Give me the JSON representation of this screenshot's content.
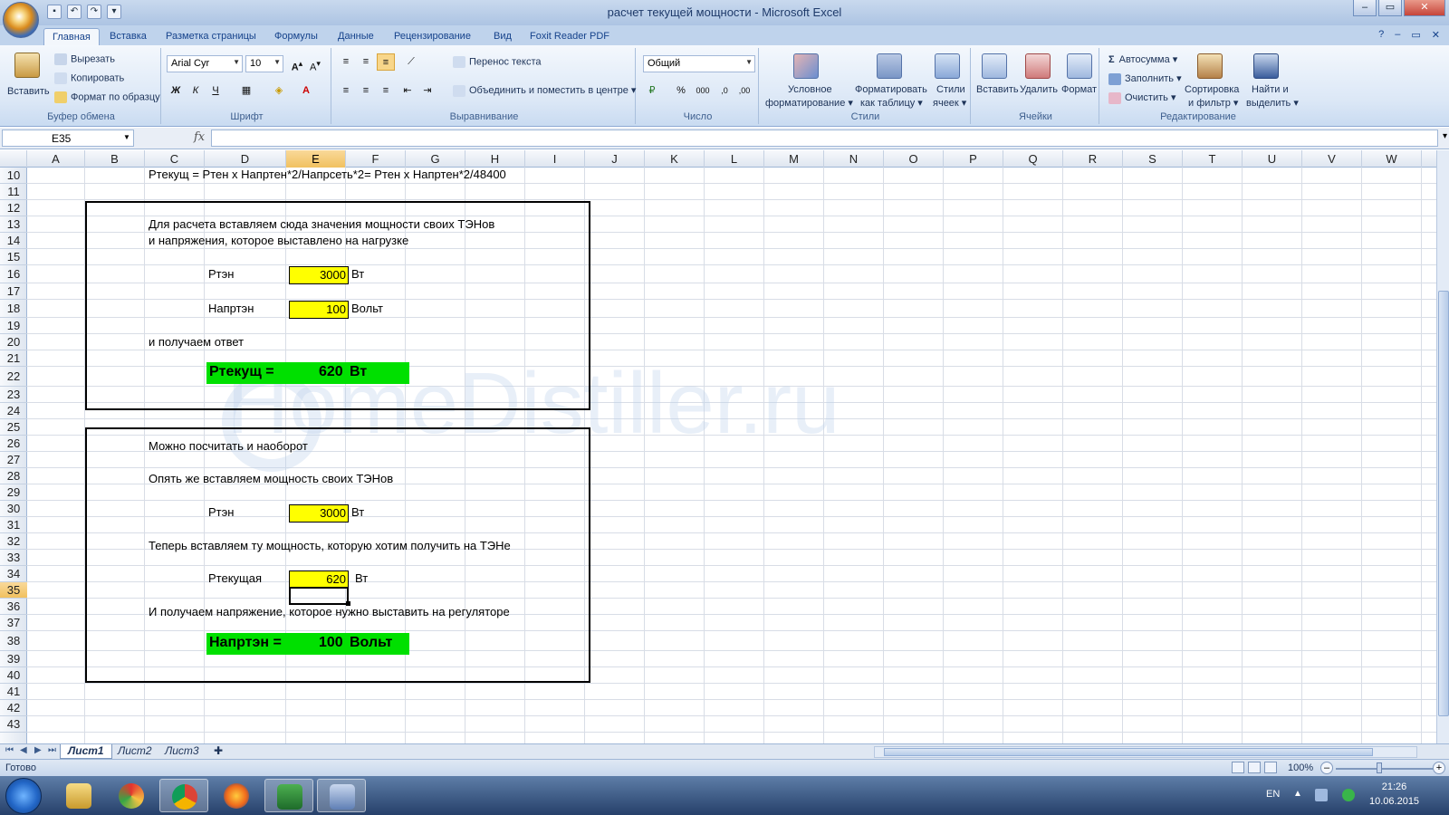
{
  "window": {
    "title": "расчет текущей мощности - Microsoft Excel",
    "controls": {
      "minimize": "–",
      "restore": "▭",
      "close": "✕"
    }
  },
  "tabs": [
    "Главная",
    "Вставка",
    "Разметка страницы",
    "Формулы",
    "Данные",
    "Рецензирование",
    "Вид",
    "Foxit Reader PDF"
  ],
  "ribbon": {
    "clipboard": {
      "paste": "Вставить",
      "cut": "Вырезать",
      "copy": "Копировать",
      "format_painter": "Формат по образцу",
      "label": "Буфер обмена"
    },
    "font": {
      "name": "Arial Cyr",
      "size": "10",
      "bold": "Ж",
      "italic": "К",
      "underline": "Ч",
      "label": "Шрифт"
    },
    "alignment": {
      "wrap": "Перенос текста",
      "merge": "Объединить и поместить в центре",
      "label": "Выравнивание"
    },
    "number": {
      "format": "Общий",
      "percent": "%",
      "thousands": "000",
      "label": "Число"
    },
    "styles": {
      "conditional": "Условное",
      "conditional2": "форматирование",
      "format_table": "Форматировать",
      "format_table2": "как таблицу",
      "cell_styles": "Стили",
      "cell_styles2": "ячеек",
      "label": "Стили"
    },
    "cells": {
      "insert": "Вставить",
      "delete": "Удалить",
      "format": "Формат",
      "label": "Ячейки"
    },
    "editing": {
      "autosum": "Автосумма",
      "fill": "Заполнить",
      "clear": "Очистить",
      "sort": "Сортировка",
      "sort2": "и фильтр",
      "find": "Найти и",
      "find2": "выделить",
      "label": "Редактирование"
    }
  },
  "formula_bar": {
    "name_box": "E35",
    "fx": "fx",
    "value": ""
  },
  "columns": [
    "A",
    "B",
    "C",
    "D",
    "E",
    "F",
    "G",
    "H",
    "I",
    "J",
    "K",
    "L",
    "M",
    "N",
    "O",
    "P",
    "Q",
    "R",
    "S",
    "T",
    "U",
    "V",
    "W"
  ],
  "selected_column": "E",
  "rows": [
    "10",
    "11",
    "12",
    "13",
    "14",
    "15",
    "16",
    "17",
    "18",
    "19",
    "20",
    "21",
    "22",
    "23",
    "24",
    "25",
    "26",
    "27",
    "28",
    "29",
    "30",
    "31",
    "32",
    "33",
    "34",
    "35",
    "36",
    "37",
    "38",
    "39",
    "40",
    "41",
    "42",
    "43"
  ],
  "selected_row": "35",
  "sheet": {
    "formula_line": "Ртекущ = Ртен х Напртен*2/Напрсеть*2= Ртен х Напртен*2/48400",
    "block1": {
      "intro1": "Для расчета  вставляем сюда значения мощности своих ТЭНов",
      "intro2": "и напряжения, которое выставлено на нагрузке",
      "p_label": "Ртэн",
      "p_value": "3000",
      "p_unit": "Вт",
      "u_label": "Напртэн",
      "u_value": "100",
      "u_unit": "Вольт",
      "answer_intro": "и получаем ответ",
      "result_label": "Ртекущ =",
      "result_value": "620",
      "result_unit": "Вт"
    },
    "block2": {
      "intro": "Можно посчитать и наоборот",
      "intro2": "Опять же вставляем мощность своих ТЭНов",
      "p_label": "Ртэн",
      "p_value": "3000",
      "p_unit": "Вт",
      "want_intro": "Теперь вставляем ту мощность, которую хотим получить на ТЭНе",
      "cur_label": "Ртекущая",
      "cur_value": "620",
      "cur_unit": "Вт",
      "result_intro": "И получаем напряжение, которое нужно выставить на регуляторе",
      "result_label": "Напртэн =",
      "result_value": "100",
      "result_unit": "Вольт"
    },
    "watermark": "HomeDistiller.ru"
  },
  "sheet_tabs": [
    "Лист1",
    "Лист2",
    "Лист3"
  ],
  "status": {
    "text": "Готово",
    "zoom": "100%"
  },
  "taskbar": {
    "lang": "EN",
    "time": "21:26",
    "date": "10.06.2015"
  }
}
